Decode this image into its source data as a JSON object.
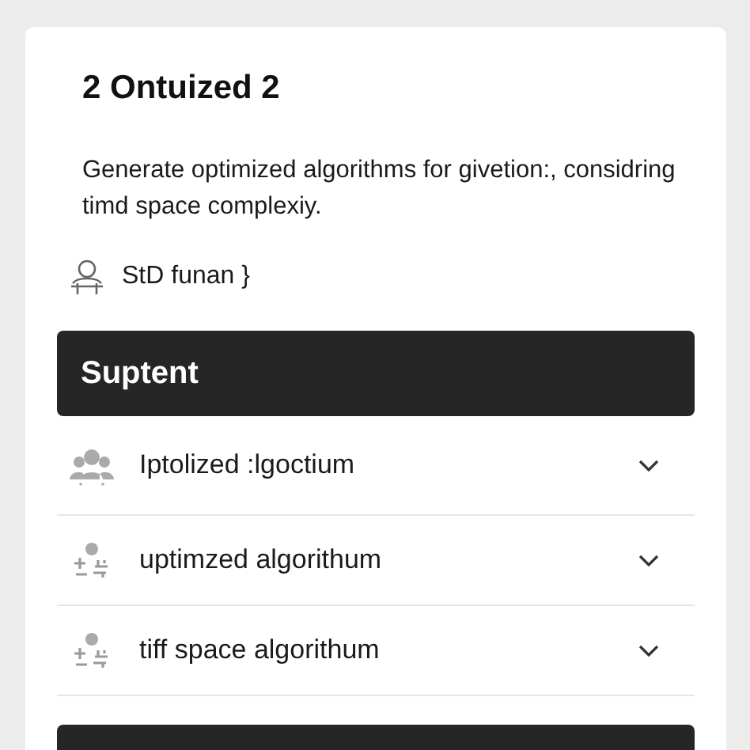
{
  "title": "2 Ontuized 2",
  "description": "Generate optimized algorithms for givetion:, considring timd space complexiy.",
  "author": {
    "name": "StD funan }"
  },
  "section": {
    "title": "Suptent",
    "items": [
      {
        "kind": "group",
        "label": "Iptolized :lgoctium"
      },
      {
        "kind": "adjust",
        "label": "uptimzed algorithum"
      },
      {
        "kind": "adjust",
        "label": "tiff space algorithum"
      }
    ]
  }
}
